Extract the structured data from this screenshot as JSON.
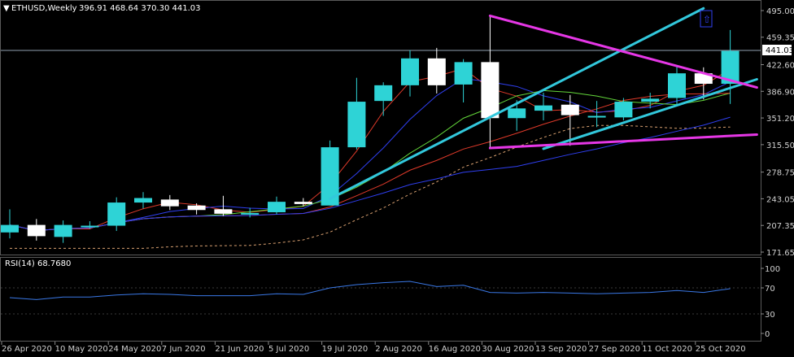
{
  "header": {
    "symbol": "ETHUSD,Weekly",
    "ohlc": "396.91 468.64 370.30 441.03",
    "rsi_label": "RSI(14) 68.7680"
  },
  "colors": {
    "background": "#000000",
    "frame": "#5a5a5a",
    "bull_candle": "#2ed3d6",
    "bear_candle": "#ffffff",
    "trendline_cyan": "#32c8dc",
    "trendline_magenta": "#e637e6",
    "ma_red": "#e03a2a",
    "ma_green": "#63d63a",
    "ma_blue": "#2f3ff0",
    "rsi_line": "#3a78e6",
    "bid_line": "#8fa0b0",
    "price_box_bg": "#ffffff"
  },
  "price_axis": {
    "ticks": [
      "495.00",
      "459.35",
      "422.60",
      "386.90",
      "351.20",
      "315.50",
      "278.75",
      "243.05",
      "207.35",
      "171.65"
    ],
    "current_price": "441.03"
  },
  "time_axis": {
    "labels": [
      "26 Apr 2020",
      "10 May 2020",
      "24 May 2020",
      "7 Jun 2020",
      "21 Jun 2020",
      "5 Jul 2020",
      "19 Jul 2020",
      "2 Aug 2020",
      "16 Aug 2020",
      "30 Aug 2020",
      "13 Sep 2020",
      "27 Sep 2020",
      "11 Oct 2020",
      "25 Oct 2020"
    ]
  },
  "rsi_axis": {
    "ticks": [
      "100",
      "70",
      "30",
      "0"
    ]
  },
  "chart_data": [
    {
      "type": "candlestick",
      "title": "ETHUSD,Weekly",
      "ylim": [
        171.65,
        495.0
      ],
      "candles": [
        {
          "x": "26 Apr 2020",
          "open": 198,
          "high": 229,
          "low": 190,
          "close": 208
        },
        {
          "x": "3 May 2020",
          "open": 208,
          "high": 216,
          "low": 187,
          "close": 193
        },
        {
          "x": "10 May 2020",
          "open": 192,
          "high": 214,
          "low": 184,
          "close": 208
        },
        {
          "x": "17 May 2020",
          "open": 207,
          "high": 213,
          "low": 203,
          "close": 207
        },
        {
          "x": "24 May 2020",
          "open": 207,
          "high": 245,
          "low": 200,
          "close": 238
        },
        {
          "x": "31 May 2020",
          "open": 238,
          "high": 252,
          "low": 230,
          "close": 244
        },
        {
          "x": "7 Jun 2020",
          "open": 242,
          "high": 248,
          "low": 228,
          "close": 233
        },
        {
          "x": "14 Jun 2020",
          "open": 234,
          "high": 237,
          "low": 222,
          "close": 228
        },
        {
          "x": "21 Jun 2020",
          "open": 229,
          "high": 247,
          "low": 220,
          "close": 223
        },
        {
          "x": "28 Jun 2020",
          "open": 223,
          "high": 231,
          "low": 218,
          "close": 224
        },
        {
          "x": "5 Jul 2020",
          "open": 225,
          "high": 246,
          "low": 222,
          "close": 239
        },
        {
          "x": "12 Jul 2020",
          "open": 239,
          "high": 244,
          "low": 233,
          "close": 236
        },
        {
          "x": "19 Jul 2020",
          "open": 234,
          "high": 321,
          "low": 234,
          "close": 312
        },
        {
          "x": "26 Jul 2020",
          "open": 312,
          "high": 405,
          "low": 309,
          "close": 373
        },
        {
          "x": "2 Aug 2020",
          "open": 374,
          "high": 399,
          "low": 354,
          "close": 395
        },
        {
          "x": "9 Aug 2020",
          "open": 395,
          "high": 442,
          "low": 380,
          "close": 431
        },
        {
          "x": "16 Aug 2020",
          "open": 431,
          "high": 445,
          "low": 384,
          "close": 395
        },
        {
          "x": "23 Aug 2020",
          "open": 396,
          "high": 430,
          "low": 372,
          "close": 426
        },
        {
          "x": "30 Aug 2020",
          "open": 426,
          "high": 488,
          "low": 310,
          "close": 351
        },
        {
          "x": "6 Sep 2020",
          "open": 351,
          "high": 375,
          "low": 334,
          "close": 364
        },
        {
          "x": "13 Sep 2020",
          "open": 361,
          "high": 385,
          "low": 348,
          "close": 368
        },
        {
          "x": "20 Sep 2020",
          "open": 369,
          "high": 382,
          "low": 314,
          "close": 355
        },
        {
          "x": "27 Sep 2020",
          "open": 354,
          "high": 374,
          "low": 339,
          "close": 354
        },
        {
          "x": "4 Oct 2020",
          "open": 352,
          "high": 378,
          "low": 348,
          "close": 373
        },
        {
          "x": "11 Oct 2020",
          "open": 373,
          "high": 385,
          "low": 364,
          "close": 377
        },
        {
          "x": "18 Oct 2020",
          "open": 378,
          "high": 420,
          "low": 367,
          "close": 411
        },
        {
          "x": "25 Oct 2020",
          "open": 411,
          "high": 419,
          "low": 376,
          "close": 397
        },
        {
          "x": "1 Nov 2020",
          "open": 397,
          "high": 469,
          "low": 370,
          "close": 441
        }
      ],
      "lines": [
        {
          "color": "#32c8dc",
          "from": {
            "x": "19 Jul 2020",
            "y": 243
          },
          "to": {
            "x": "25 Oct 2020",
            "y": 498
          }
        },
        {
          "color": "#32c8dc",
          "from": {
            "x": "13 Sep 2020",
            "y": 310
          },
          "to": {
            "x": "8 Nov 2020",
            "y": 403
          }
        },
        {
          "color": "#e637e6",
          "from": {
            "x": "30 Aug 2020",
            "y": 488
          },
          "to": {
            "x": "8 Nov 2020",
            "y": 392
          }
        },
        {
          "color": "#e637e6",
          "from": {
            "x": "30 Aug 2020",
            "y": 311
          },
          "to": {
            "x": "8 Nov 2020",
            "y": 329
          }
        }
      ]
    },
    {
      "type": "line",
      "title": "RSI(14) 68.7680",
      "ylim": [
        0,
        100
      ],
      "x": [
        "26 Apr 2020",
        "3 May 2020",
        "10 May 2020",
        "17 May 2020",
        "24 May 2020",
        "31 May 2020",
        "7 Jun 2020",
        "14 Jun 2020",
        "21 Jun 2020",
        "28 Jun 2020",
        "5 Jul 2020",
        "12 Jul 2020",
        "19 Jul 2020",
        "26 Jul 2020",
        "2 Aug 2020",
        "9 Aug 2020",
        "16 Aug 2020",
        "23 Aug 2020",
        "30 Aug 2020",
        "6 Sep 2020",
        "13 Sep 2020",
        "20 Sep 2020",
        "27 Sep 2020",
        "4 Oct 2020",
        "11 Oct 2020",
        "18 Oct 2020",
        "25 Oct 2020",
        "1 Nov 2020"
      ],
      "values": [
        55,
        52,
        56,
        56,
        59,
        61,
        60,
        58,
        58,
        58,
        61,
        60,
        70,
        75,
        78,
        80,
        72,
        74,
        63,
        62,
        63,
        62,
        61,
        62,
        63,
        66,
        63,
        68.77
      ]
    }
  ]
}
